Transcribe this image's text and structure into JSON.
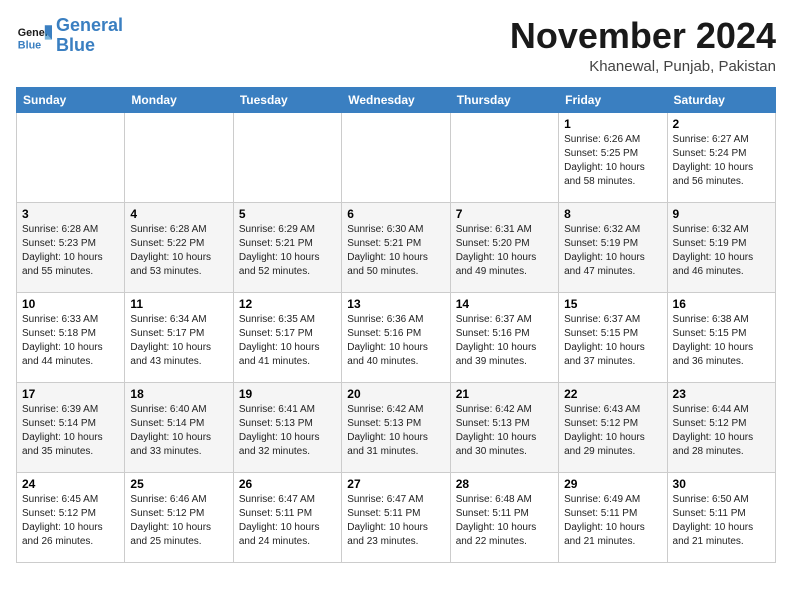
{
  "logo": {
    "text_general": "General",
    "text_blue": "Blue"
  },
  "header": {
    "month": "November 2024",
    "location": "Khanewal, Punjab, Pakistan"
  },
  "days_of_week": [
    "Sunday",
    "Monday",
    "Tuesday",
    "Wednesday",
    "Thursday",
    "Friday",
    "Saturday"
  ],
  "weeks": [
    [
      {
        "day": "",
        "info": ""
      },
      {
        "day": "",
        "info": ""
      },
      {
        "day": "",
        "info": ""
      },
      {
        "day": "",
        "info": ""
      },
      {
        "day": "",
        "info": ""
      },
      {
        "day": "1",
        "info": "Sunrise: 6:26 AM\nSunset: 5:25 PM\nDaylight: 10 hours\nand 58 minutes."
      },
      {
        "day": "2",
        "info": "Sunrise: 6:27 AM\nSunset: 5:24 PM\nDaylight: 10 hours\nand 56 minutes."
      }
    ],
    [
      {
        "day": "3",
        "info": "Sunrise: 6:28 AM\nSunset: 5:23 PM\nDaylight: 10 hours\nand 55 minutes."
      },
      {
        "day": "4",
        "info": "Sunrise: 6:28 AM\nSunset: 5:22 PM\nDaylight: 10 hours\nand 53 minutes."
      },
      {
        "day": "5",
        "info": "Sunrise: 6:29 AM\nSunset: 5:21 PM\nDaylight: 10 hours\nand 52 minutes."
      },
      {
        "day": "6",
        "info": "Sunrise: 6:30 AM\nSunset: 5:21 PM\nDaylight: 10 hours\nand 50 minutes."
      },
      {
        "day": "7",
        "info": "Sunrise: 6:31 AM\nSunset: 5:20 PM\nDaylight: 10 hours\nand 49 minutes."
      },
      {
        "day": "8",
        "info": "Sunrise: 6:32 AM\nSunset: 5:19 PM\nDaylight: 10 hours\nand 47 minutes."
      },
      {
        "day": "9",
        "info": "Sunrise: 6:32 AM\nSunset: 5:19 PM\nDaylight: 10 hours\nand 46 minutes."
      }
    ],
    [
      {
        "day": "10",
        "info": "Sunrise: 6:33 AM\nSunset: 5:18 PM\nDaylight: 10 hours\nand 44 minutes."
      },
      {
        "day": "11",
        "info": "Sunrise: 6:34 AM\nSunset: 5:17 PM\nDaylight: 10 hours\nand 43 minutes."
      },
      {
        "day": "12",
        "info": "Sunrise: 6:35 AM\nSunset: 5:17 PM\nDaylight: 10 hours\nand 41 minutes."
      },
      {
        "day": "13",
        "info": "Sunrise: 6:36 AM\nSunset: 5:16 PM\nDaylight: 10 hours\nand 40 minutes."
      },
      {
        "day": "14",
        "info": "Sunrise: 6:37 AM\nSunset: 5:16 PM\nDaylight: 10 hours\nand 39 minutes."
      },
      {
        "day": "15",
        "info": "Sunrise: 6:37 AM\nSunset: 5:15 PM\nDaylight: 10 hours\nand 37 minutes."
      },
      {
        "day": "16",
        "info": "Sunrise: 6:38 AM\nSunset: 5:15 PM\nDaylight: 10 hours\nand 36 minutes."
      }
    ],
    [
      {
        "day": "17",
        "info": "Sunrise: 6:39 AM\nSunset: 5:14 PM\nDaylight: 10 hours\nand 35 minutes."
      },
      {
        "day": "18",
        "info": "Sunrise: 6:40 AM\nSunset: 5:14 PM\nDaylight: 10 hours\nand 33 minutes."
      },
      {
        "day": "19",
        "info": "Sunrise: 6:41 AM\nSunset: 5:13 PM\nDaylight: 10 hours\nand 32 minutes."
      },
      {
        "day": "20",
        "info": "Sunrise: 6:42 AM\nSunset: 5:13 PM\nDaylight: 10 hours\nand 31 minutes."
      },
      {
        "day": "21",
        "info": "Sunrise: 6:42 AM\nSunset: 5:13 PM\nDaylight: 10 hours\nand 30 minutes."
      },
      {
        "day": "22",
        "info": "Sunrise: 6:43 AM\nSunset: 5:12 PM\nDaylight: 10 hours\nand 29 minutes."
      },
      {
        "day": "23",
        "info": "Sunrise: 6:44 AM\nSunset: 5:12 PM\nDaylight: 10 hours\nand 28 minutes."
      }
    ],
    [
      {
        "day": "24",
        "info": "Sunrise: 6:45 AM\nSunset: 5:12 PM\nDaylight: 10 hours\nand 26 minutes."
      },
      {
        "day": "25",
        "info": "Sunrise: 6:46 AM\nSunset: 5:12 PM\nDaylight: 10 hours\nand 25 minutes."
      },
      {
        "day": "26",
        "info": "Sunrise: 6:47 AM\nSunset: 5:11 PM\nDaylight: 10 hours\nand 24 minutes."
      },
      {
        "day": "27",
        "info": "Sunrise: 6:47 AM\nSunset: 5:11 PM\nDaylight: 10 hours\nand 23 minutes."
      },
      {
        "day": "28",
        "info": "Sunrise: 6:48 AM\nSunset: 5:11 PM\nDaylight: 10 hours\nand 22 minutes."
      },
      {
        "day": "29",
        "info": "Sunrise: 6:49 AM\nSunset: 5:11 PM\nDaylight: 10 hours\nand 21 minutes."
      },
      {
        "day": "30",
        "info": "Sunrise: 6:50 AM\nSunset: 5:11 PM\nDaylight: 10 hours\nand 21 minutes."
      }
    ]
  ]
}
